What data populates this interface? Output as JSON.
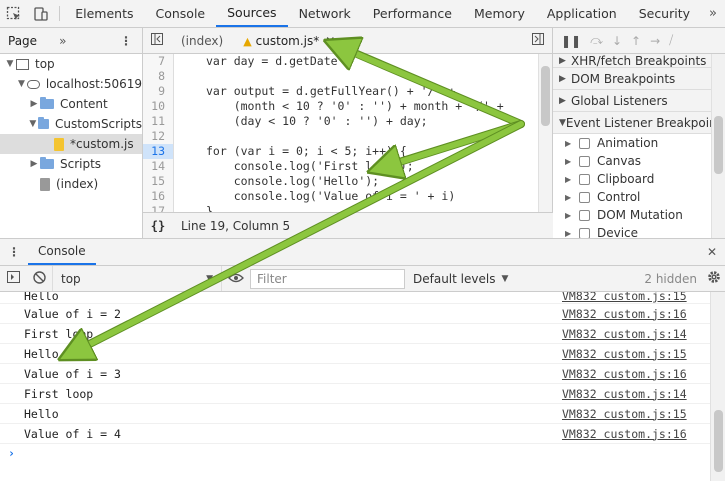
{
  "main_tabs": [
    "Elements",
    "Console",
    "Sources",
    "Network",
    "Performance",
    "Memory",
    "Application",
    "Security"
  ],
  "main_tabs_active": 2,
  "main_more": "»",
  "navigator": {
    "tab": "Page",
    "more": "»",
    "tree": [
      {
        "label": "top",
        "icon": "frame",
        "arrow": "▼",
        "indent": 4,
        "selected": false
      },
      {
        "label": "localhost:50619",
        "icon": "cloud",
        "arrow": "▼",
        "indent": 16,
        "selected": false
      },
      {
        "label": "Content",
        "icon": "folder",
        "arrow": "▶",
        "indent": 28,
        "selected": false
      },
      {
        "label": "CustomScripts",
        "icon": "folder",
        "arrow": "▼",
        "indent": 28,
        "selected": false
      },
      {
        "label": "*custom.js",
        "icon": "file-js",
        "arrow": "",
        "indent": 42,
        "selected": true
      },
      {
        "label": "Scripts",
        "icon": "folder",
        "arrow": "▶",
        "indent": 28,
        "selected": false
      },
      {
        "label": "(index)",
        "icon": "file-doc",
        "arrow": "",
        "indent": 28,
        "selected": false
      }
    ]
  },
  "editor": {
    "tabs": [
      {
        "label": "(index)",
        "warn": false,
        "close": false,
        "active": false
      },
      {
        "label": "custom.js*",
        "warn": true,
        "close": true,
        "active": true
      }
    ],
    "lines": [
      {
        "n": "7",
        "text": "var day = d.getDate",
        "bp": false
      },
      {
        "n": "8",
        "text": "",
        "bp": false
      },
      {
        "n": "9",
        "text": "var output = d.getFullYear() + '/' +",
        "bp": false
      },
      {
        "n": "10",
        "text": "    (month < 10 ? '0' : '') + month + '/' +",
        "bp": false
      },
      {
        "n": "11",
        "text": "    (day < 10 ? '0' : '') + day;",
        "bp": false
      },
      {
        "n": "12",
        "text": "",
        "bp": false
      },
      {
        "n": "13",
        "text": "for (var i = 0; i < 5; i++) {",
        "bp": true
      },
      {
        "n": "14",
        "text": "    console.log('First loop');",
        "bp": false
      },
      {
        "n": "15",
        "text": "    console.log('Hello');",
        "bp": false
      },
      {
        "n": "16",
        "text": "    console.log('Value of i = ' + i)",
        "bp": false
      },
      {
        "n": "17",
        "text": "}",
        "bp": false
      }
    ],
    "status": {
      "braces": "{}",
      "position": "Line 19, Column 5"
    }
  },
  "debugger": {
    "sections": [
      "XHR/fetch Breakpoints",
      "DOM Breakpoints",
      "Global Listeners",
      "Event Listener Breakpoints"
    ],
    "events": [
      "Animation",
      "Canvas",
      "Clipboard",
      "Control",
      "DOM Mutation",
      "Device"
    ]
  },
  "drawer": {
    "tab": "Console",
    "context": "top",
    "filter_placeholder": "Filter",
    "levels": "Default levels",
    "hidden": "2 hidden"
  },
  "console_rows": [
    {
      "msg": "Hello",
      "link": "VM832 custom.js:15"
    },
    {
      "msg": "Value of i = 2",
      "link": "VM832 custom.js:16"
    },
    {
      "msg": "First loop",
      "link": "VM832 custom.js:14"
    },
    {
      "msg": "Hello",
      "link": "VM832 custom.js:15"
    },
    {
      "msg": "Value of i = 3",
      "link": "VM832 custom.js:16"
    },
    {
      "msg": "First loop",
      "link": "VM832 custom.js:14"
    },
    {
      "msg": "Hello",
      "link": "VM832 custom.js:15"
    },
    {
      "msg": "Value of i = 4",
      "link": "VM832 custom.js:16"
    }
  ],
  "prompt": "›",
  "colors": {
    "accent": "#1a73e8",
    "arrow": "#8cc63f",
    "arrow_outline": "#5e8f22"
  }
}
